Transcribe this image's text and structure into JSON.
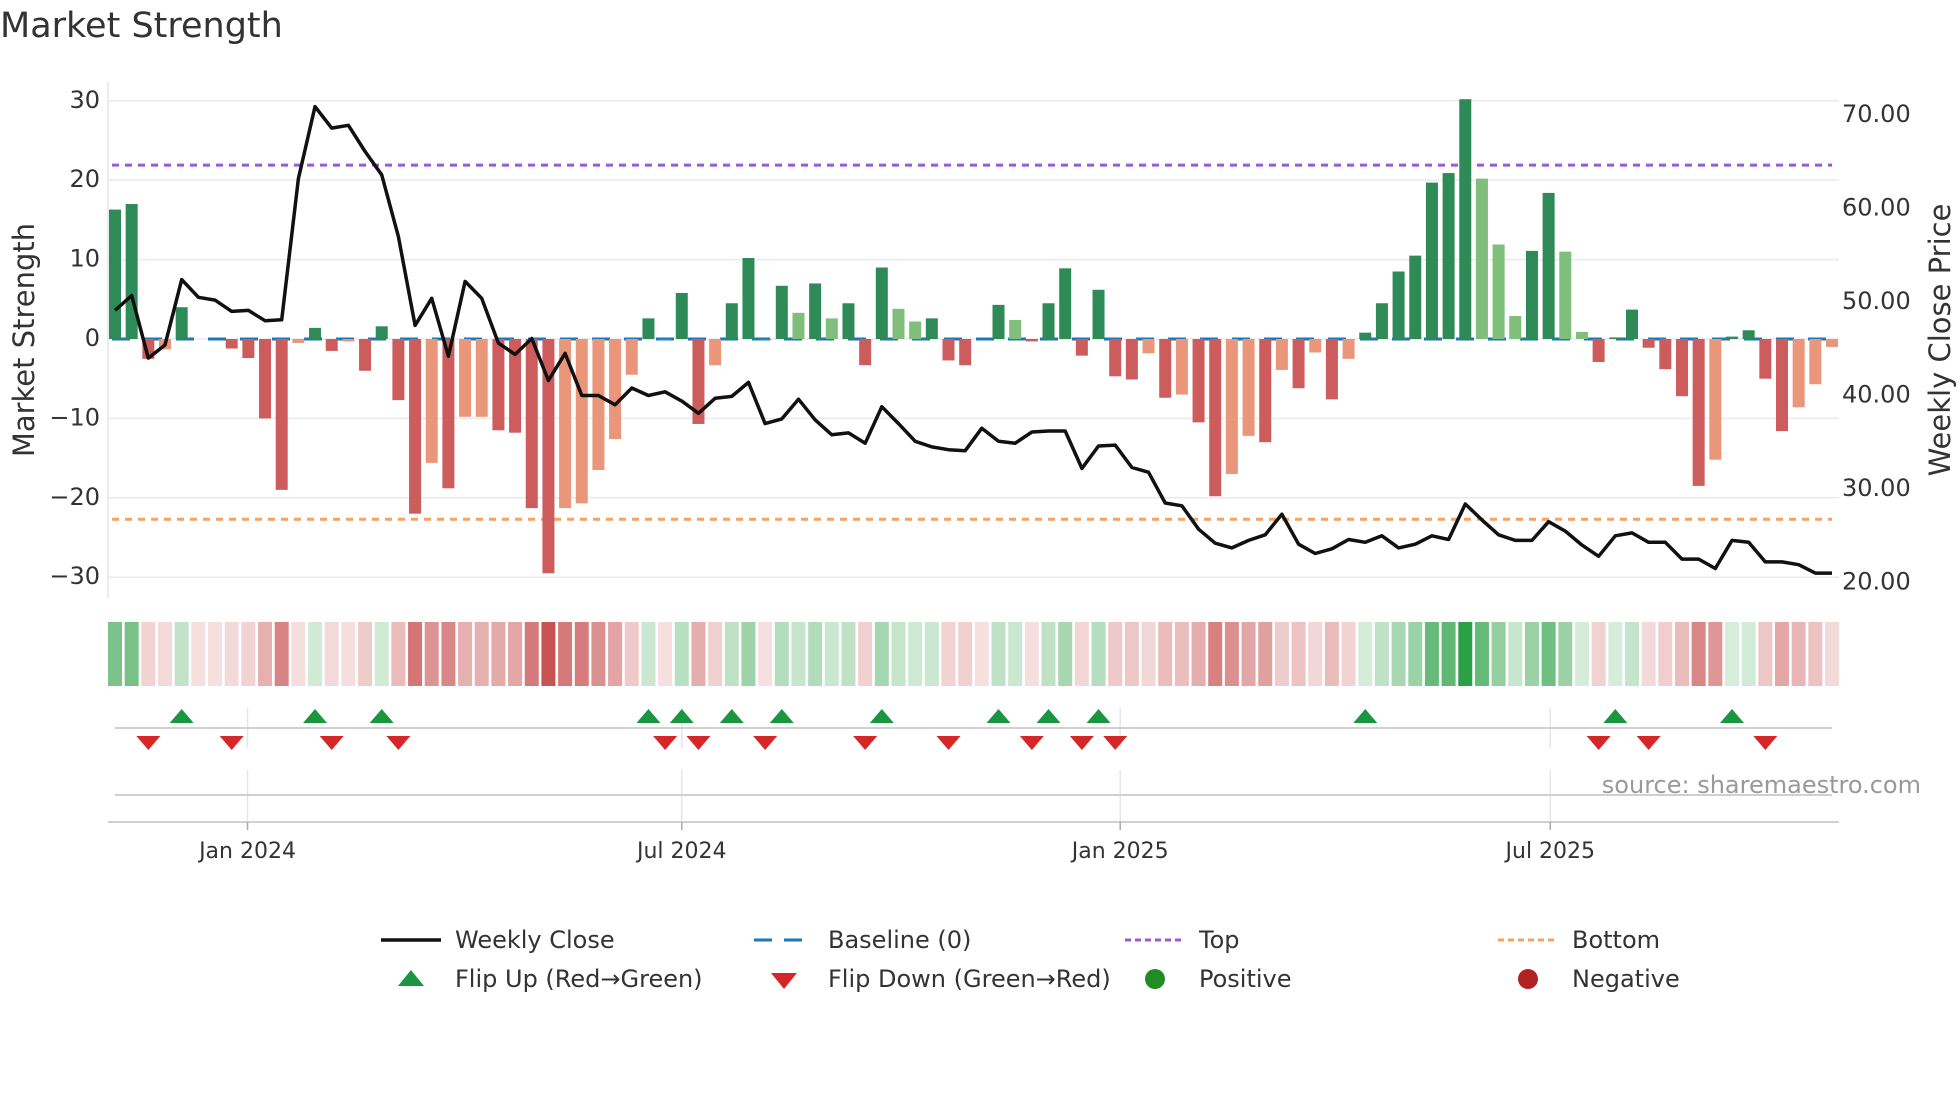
{
  "title": "Market Strength",
  "source": "source: sharemaestro.com",
  "colors": {
    "strong_green": "#2e8b57",
    "weak_green": "#7fbf7b",
    "strong_red": "#cd5c5c",
    "weak_red": "#e9967a",
    "baseline": "#1f77b4",
    "top": "#9b59d6",
    "bottom": "#f4a460",
    "close": "#111111",
    "flip_up": "#1a9641",
    "flip_down": "#d62728",
    "positive": "#228b22",
    "negative": "#b22222"
  },
  "chart_data": {
    "type": "bar",
    "title": "Market Strength",
    "ylabel": "Market Strength",
    "y2label": "Weekly Close Price",
    "ylim": [
      -32.5,
      32.5
    ],
    "y2lim": [
      18.2,
      72.1
    ],
    "yticks": [
      30,
      20,
      10,
      0,
      -10,
      -20,
      -30
    ],
    "ytick_labels": [
      "30",
      "20",
      "10",
      "0",
      "−10",
      "−20",
      "−30"
    ],
    "y2ticks": [
      70,
      60,
      50,
      40,
      30,
      20
    ],
    "y2tick_labels": [
      "70.00",
      "60.00",
      "50.00",
      "40.00",
      "30.00",
      "20.00"
    ],
    "xticks": [
      {
        "week": 7.95,
        "label": "Jan 2024"
      },
      {
        "week": 34.0,
        "label": "Jul 2024"
      },
      {
        "week": 60.3,
        "label": "Jan 2025"
      },
      {
        "week": 86.1,
        "label": "Jul 2025"
      }
    ],
    "top_level": 21.9,
    "bottom_level": -22.7,
    "baseline": 0,
    "strength": [
      16.3,
      17,
      -2.5,
      -1.3,
      4,
      0,
      0,
      -1.2,
      -2.4,
      -10,
      -19,
      -0.5,
      1.4,
      -1.5,
      -0.3,
      -4,
      1.6,
      -7.7,
      -22,
      -15.6,
      -18.8,
      -9.8,
      -9.8,
      -11.5,
      -11.8,
      -21.3,
      -29.5,
      -21.3,
      -20.7,
      -16.5,
      -12.6,
      -4.5,
      2.6,
      -0.1,
      5.8,
      -10.7,
      -3.3,
      4.5,
      10.2,
      -0.1,
      6.7,
      3.3,
      7,
      2.6,
      4.5,
      -3.3,
      9,
      3.8,
      2.2,
      2.6,
      -2.7,
      -3.3,
      0,
      4.3,
      2.4,
      -0.3,
      4.5,
      8.9,
      -2.1,
      6.2,
      -4.7,
      -5.1,
      -1.8,
      -7.4,
      -7,
      -10.5,
      -19.8,
      -17,
      -12.2,
      -13,
      -3.9,
      -6.2,
      -1.7,
      -7.6,
      -2.5,
      0.8,
      4.5,
      8.5,
      10.5,
      19.7,
      20.9,
      30.2,
      20.2,
      11.9,
      2.9,
      11.1,
      18.4,
      11,
      0.9,
      -2.9,
      0.2,
      3.7,
      -1.1,
      -3.8,
      -7.2,
      -18.5,
      -15.2,
      0.3,
      1.1,
      -5,
      -11.6,
      -8.6,
      -5.7,
      -1
    ],
    "shade": "GGRrG--RRRRrGRrRGRRrRrrRRRRrrrrrGRGRrGGRGgGgGRGggGRR-GgRGGRGRRrRrRRrrRrRrRrGGGGGGGgggGGggRGGRRRRrGGRRrrr",
    "weekly_close": [
      49.1,
      50.7,
      44.0,
      45.4,
      52.4,
      50.5,
      50.2,
      49.0,
      49.1,
      48.0,
      48.1,
      63.2,
      70.9,
      68.6,
      68.9,
      66.1,
      63.6,
      57.0,
      47.5,
      50.4,
      44.2,
      52.2,
      50.4,
      45.6,
      44.4,
      46.1,
      41.6,
      44.5,
      40.0,
      40.0,
      39.0,
      40.8,
      40.0,
      40.4,
      39.4,
      38.1,
      39.7,
      39.9,
      41.4,
      37.0,
      37.5,
      39.6,
      37.4,
      35.8,
      36.0,
      34.9,
      38.8,
      37.0,
      35.1,
      34.5,
      34.2,
      34.1,
      36.5,
      35.1,
      34.9,
      36.1,
      36.2,
      36.2,
      32.2,
      34.6,
      34.7,
      32.3,
      31.8,
      28.5,
      28.2,
      25.7,
      24.2,
      23.7,
      24.5,
      25.1,
      27.3,
      24.1,
      23.1,
      23.6,
      24.6,
      24.3,
      25.0,
      23.7,
      24.1,
      25.0,
      24.6,
      28.4,
      26.7,
      25.1,
      24.5,
      24.5,
      26.5,
      25.5,
      24.0,
      22.8,
      25.0,
      25.3,
      24.3,
      24.3,
      22.5,
      22.5,
      21.5,
      24.5,
      24.3,
      22.2,
      22.2,
      21.9,
      21.0,
      21.0
    ],
    "flip_up_weeks": [
      4,
      12,
      16,
      32,
      34,
      37,
      40,
      46,
      53,
      56,
      59,
      75,
      90,
      97
    ],
    "flip_down_weeks": [
      2,
      7,
      13,
      17,
      33,
      35,
      39,
      45,
      50,
      55,
      58,
      60,
      89,
      92,
      99
    ],
    "legend": {
      "close": "Weekly Close",
      "baseline": "Baseline (0)",
      "top": "Top",
      "bottom": "Bottom",
      "flip_up": "Flip Up (Red→Green)",
      "flip_down": "Flip Down (Green→Red)",
      "positive": "Positive",
      "negative": "Negative"
    },
    "legend_position": "bottom"
  }
}
